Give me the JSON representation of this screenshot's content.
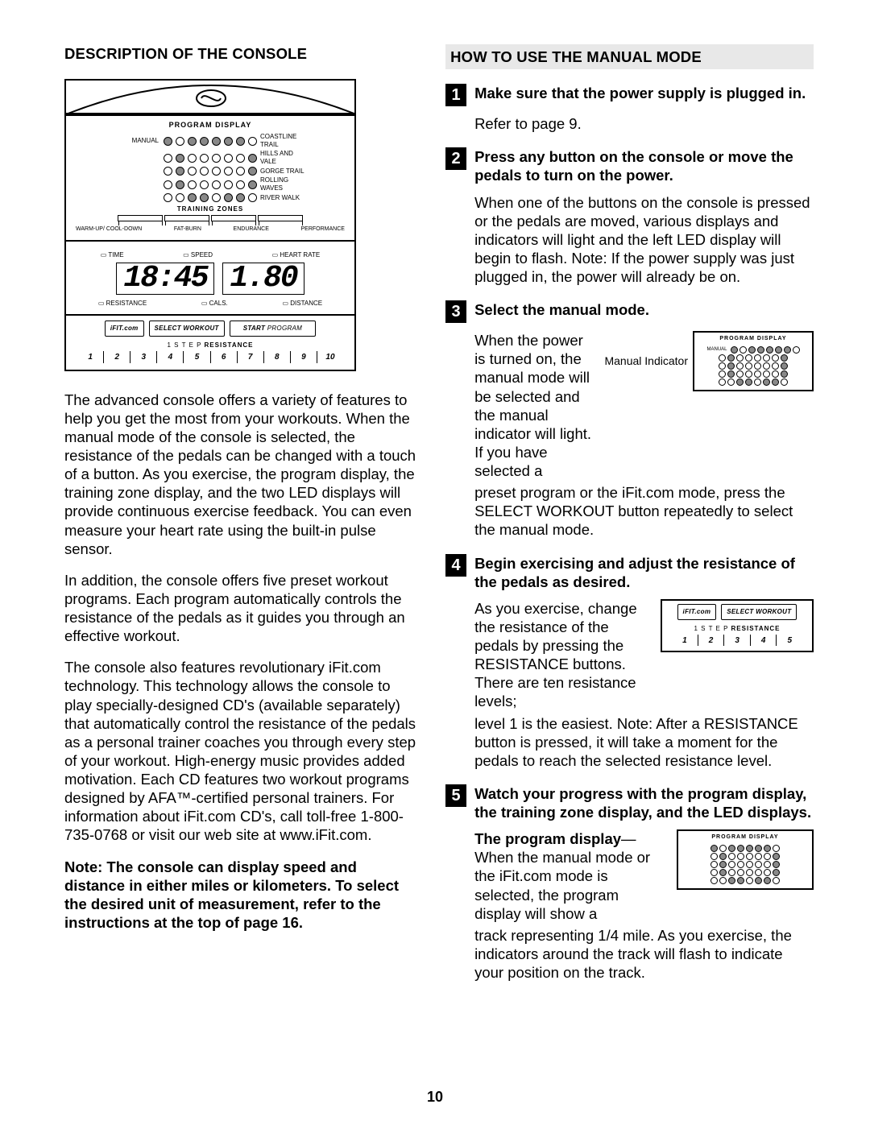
{
  "left": {
    "heading": "DESCRIPTION OF THE CONSOLE",
    "console": {
      "program_display": "PROGRAM DISPLAY",
      "manual_label": "MANUAL",
      "preset_labels": [
        "COASTLINE TRAIL",
        "HILLS AND VALE",
        "GORGE TRAIL",
        "ROLLING WAVES",
        "RIVER WALK"
      ],
      "training_zones": "TRAINING ZONES",
      "tz_labels": [
        "WARM-UP/ COOL-DOWN",
        "FAT-BURN",
        "ENDURANCE",
        "PERFORMANCE"
      ],
      "led_top": [
        "TIME",
        "SPEED",
        "HEART RATE"
      ],
      "led_left": "18:45",
      "led_right": "1.80",
      "led_bottom": [
        "RESISTANCE",
        "CALS.",
        "DISTANCE"
      ],
      "ifit": "iFIT.com",
      "select_workout": "SELECT WORKOUT",
      "start_program_a": "START",
      "start_program_b": " PROGRAM",
      "resistance_label_pre": "1 S T E P ",
      "resistance_label": "RESISTANCE",
      "resistance_nums": [
        "1",
        "2",
        "3",
        "4",
        "5",
        "6",
        "7",
        "8",
        "9",
        "10"
      ]
    },
    "p1": "The advanced console offers a variety of features to help you get the most from your workouts. When the manual mode of the console is selected, the resistance of the pedals can be changed with a touch of a button. As you exercise, the program display, the training zone display, and the two LED displays will provide continuous exercise feedback. You can even measure your heart rate using the built-in pulse sensor.",
    "p2": "In addition, the console offers five preset workout programs. Each program automatically controls the resistance of the pedals as it guides you through an effective workout.",
    "p3": "The console also features revolutionary iFit.com technology. This technology allows the console to play specially-designed CD's (available separately) that automatically control the resistance of the pedals as a personal trainer coaches you through every step of your workout. High-energy music provides added motivation. Each CD features two workout programs designed by AFA™-certified personal trainers. For information about iFit.com CD's, call toll-free 1-800-735-0768 or visit our web site at www.iFit.com.",
    "p4": "Note: The console can display speed and distance in either miles or kilometers. To select the desired unit of measurement, refer to the instructions at the top of page 16."
  },
  "right": {
    "heading": "HOW TO USE THE MANUAL MODE",
    "step1_title": "Make sure that the power supply is plugged in.",
    "step1_body": "Refer to page 9.",
    "step2_title": "Press any button on the console or move the pedals to turn on the power.",
    "step2_body": "When one of the buttons on the console is pressed or the pedals are moved, various displays and indicators will light and the left LED display will begin to flash. Note: If the power supply was just plugged in, the power will already be on.",
    "step3_title": "Select the manual mode.",
    "step3_body_a": "When the power is turned on, the manual mode will be selected and the manual indicator will light. If you have selected a",
    "step3_body_b": "preset program or the iFit.com mode, press the SELECT WORKOUT button repeatedly to select the manual mode.",
    "step3_ind_label": "Manual Indicator",
    "step4_title": "Begin exercising and adjust the resistance of the pedals as desired.",
    "step4_body_a": "As you exercise, change the resistance of the pedals by pressing the RESISTANCE buttons. There are ten resistance levels;",
    "step4_body_b": "level 1 is the easiest. Note: After a RESISTANCE button is pressed, it will take a moment for the pedals to reach the selected resistance level.",
    "step4_nums": [
      "1",
      "2",
      "3",
      "4",
      "5"
    ],
    "step5_title": "Watch your progress with the program display, the training zone display, and the LED displays.",
    "step5_lead": "The program display",
    "step5_body_a": "—When the manual mode or the iFit.com mode is selected, the program display will show a",
    "step5_body_b": "track representing 1/4 mile. As you exercise, the indicators around the track will flash to indicate your position on the track."
  },
  "page_number": "10"
}
